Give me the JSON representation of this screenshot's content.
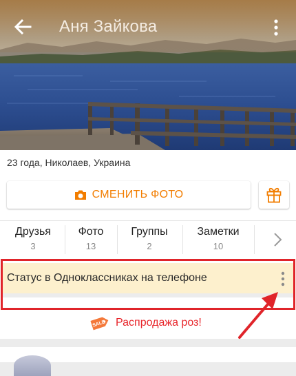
{
  "header": {
    "title": "Аня Зайкова"
  },
  "profile": {
    "details": "23 года, Николаев, Украина",
    "change_photo_label": "СМЕНИТЬ ФОТО"
  },
  "tabs": [
    {
      "label": "Друзья",
      "count": "3"
    },
    {
      "label": "Фото",
      "count": "13"
    },
    {
      "label": "Группы",
      "count": "2"
    },
    {
      "label": "Заметки",
      "count": "10"
    }
  ],
  "status": {
    "text": "Статус в Одноклассниках на телефоне"
  },
  "promo": {
    "badge": "SALE",
    "text": "Распродажа роз!"
  },
  "colors": {
    "accent": "#f27d00",
    "annotation_red": "#e0242a",
    "status_bg": "#fdf0cd"
  },
  "icons": {
    "back": "back-arrow-icon",
    "menu": "kebab-menu-icon",
    "camera": "camera-icon",
    "gift": "gift-icon",
    "tabs_next": "chevron-right-icon",
    "status_more": "vertical-dots-icon",
    "sale": "sale-tag-icon"
  }
}
